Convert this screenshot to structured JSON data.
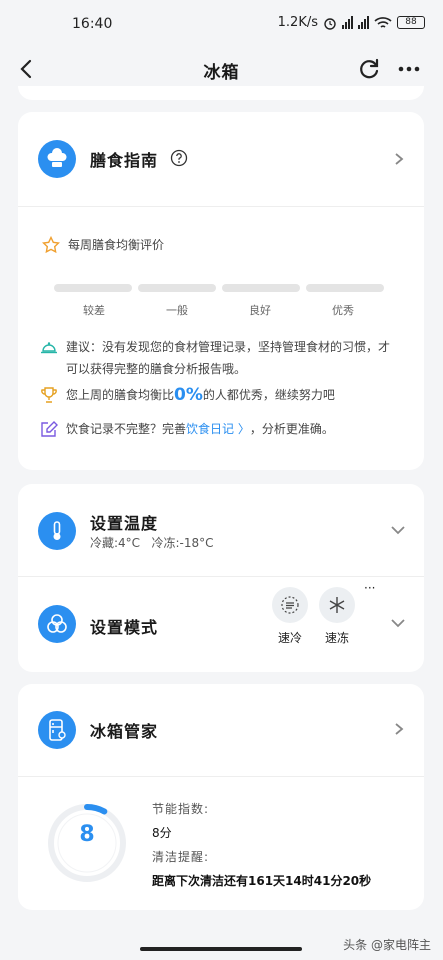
{
  "status": {
    "time": "16:40",
    "speed": "1.2K/s",
    "battery": "88"
  },
  "header": {
    "title": "冰箱"
  },
  "diet": {
    "title": "膳食指南",
    "weekly_label": "每周膳食均衡评价",
    "levels": [
      "较差",
      "一般",
      "良好",
      "优秀"
    ],
    "tip1": "建议：没有发现您的食材管理记录，坚持管理食材的习惯，才可以获得完整的膳食分析报告哦。",
    "tip2_before": "您上周的膳食均衡比",
    "tip2_value": "0%",
    "tip2_after": "的人都优秀，继续努力吧",
    "tip3_before": "饮食记录不完整？完善",
    "tip3_link": "饮食日记 〉",
    "tip3_after": "，分析更准确。"
  },
  "temp": {
    "title": "设置温度",
    "subtitle": "冷藏:4°C   冷冻:-18°C"
  },
  "mode": {
    "title": "设置模式",
    "modes": [
      "速冷",
      "速冻"
    ],
    "more": "···"
  },
  "manager": {
    "title": "冰箱管家",
    "score": "8",
    "score_progress": 0.08,
    "energy_label": "节能指数:",
    "energy_value": "8分",
    "clean_label": "清洁提醒:",
    "clean_value": "距离下次清洁还有161天14时41分20秒"
  },
  "watermark": "头条 @家电阵主"
}
